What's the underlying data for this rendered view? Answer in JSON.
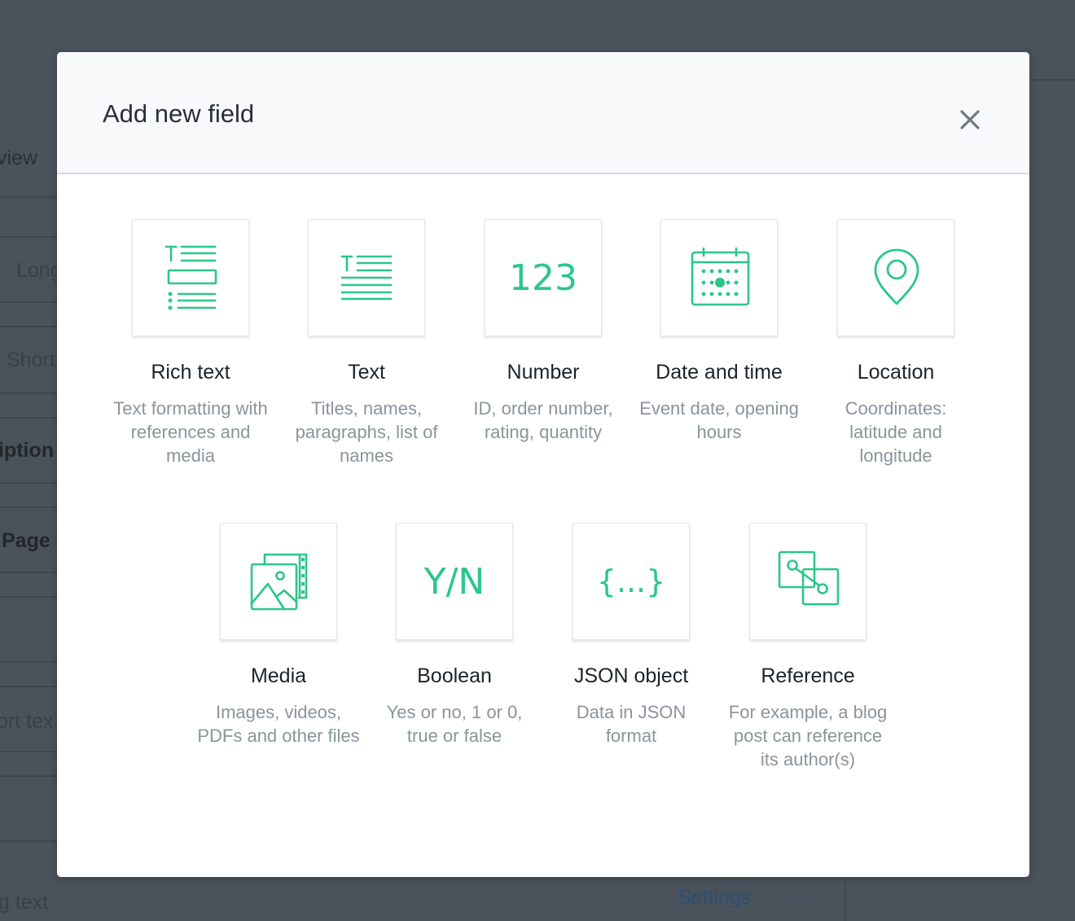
{
  "background": {
    "items": [
      "view",
      "Long",
      "Short",
      "iption",
      "Page",
      "ort tex",
      "g text"
    ],
    "settings_label": "Settings",
    "more_label": "···"
  },
  "modal": {
    "title": "Add new field",
    "close_icon": "close-icon",
    "accent_color": "#2cc689"
  },
  "fields": [
    {
      "title": "Rich text",
      "description": "Text formatting with references and media",
      "icon": "rich-text-icon"
    },
    {
      "title": "Text",
      "description": "Titles, names, paragraphs, list of names",
      "icon": "text-icon"
    },
    {
      "title": "Number",
      "description": "ID, order number, rating, quantity",
      "icon": "number-icon",
      "glyph": "123"
    },
    {
      "title": "Date and time",
      "description": "Event date, opening hours",
      "icon": "calendar-icon"
    },
    {
      "title": "Location",
      "description": "Coordinates: latitude and longitude",
      "icon": "location-pin-icon"
    },
    {
      "title": "Media",
      "description": "Images, videos, PDFs and other files",
      "icon": "media-icon"
    },
    {
      "title": "Boolean",
      "description": "Yes or no, 1 or 0, true or false",
      "icon": "boolean-icon",
      "glyph": "Y/N"
    },
    {
      "title": "JSON object",
      "description": "Data in JSON format",
      "icon": "json-icon",
      "glyph": "{...}"
    },
    {
      "title": "Reference",
      "description": "For example, a blog post can reference its author(s)",
      "icon": "reference-icon"
    }
  ]
}
